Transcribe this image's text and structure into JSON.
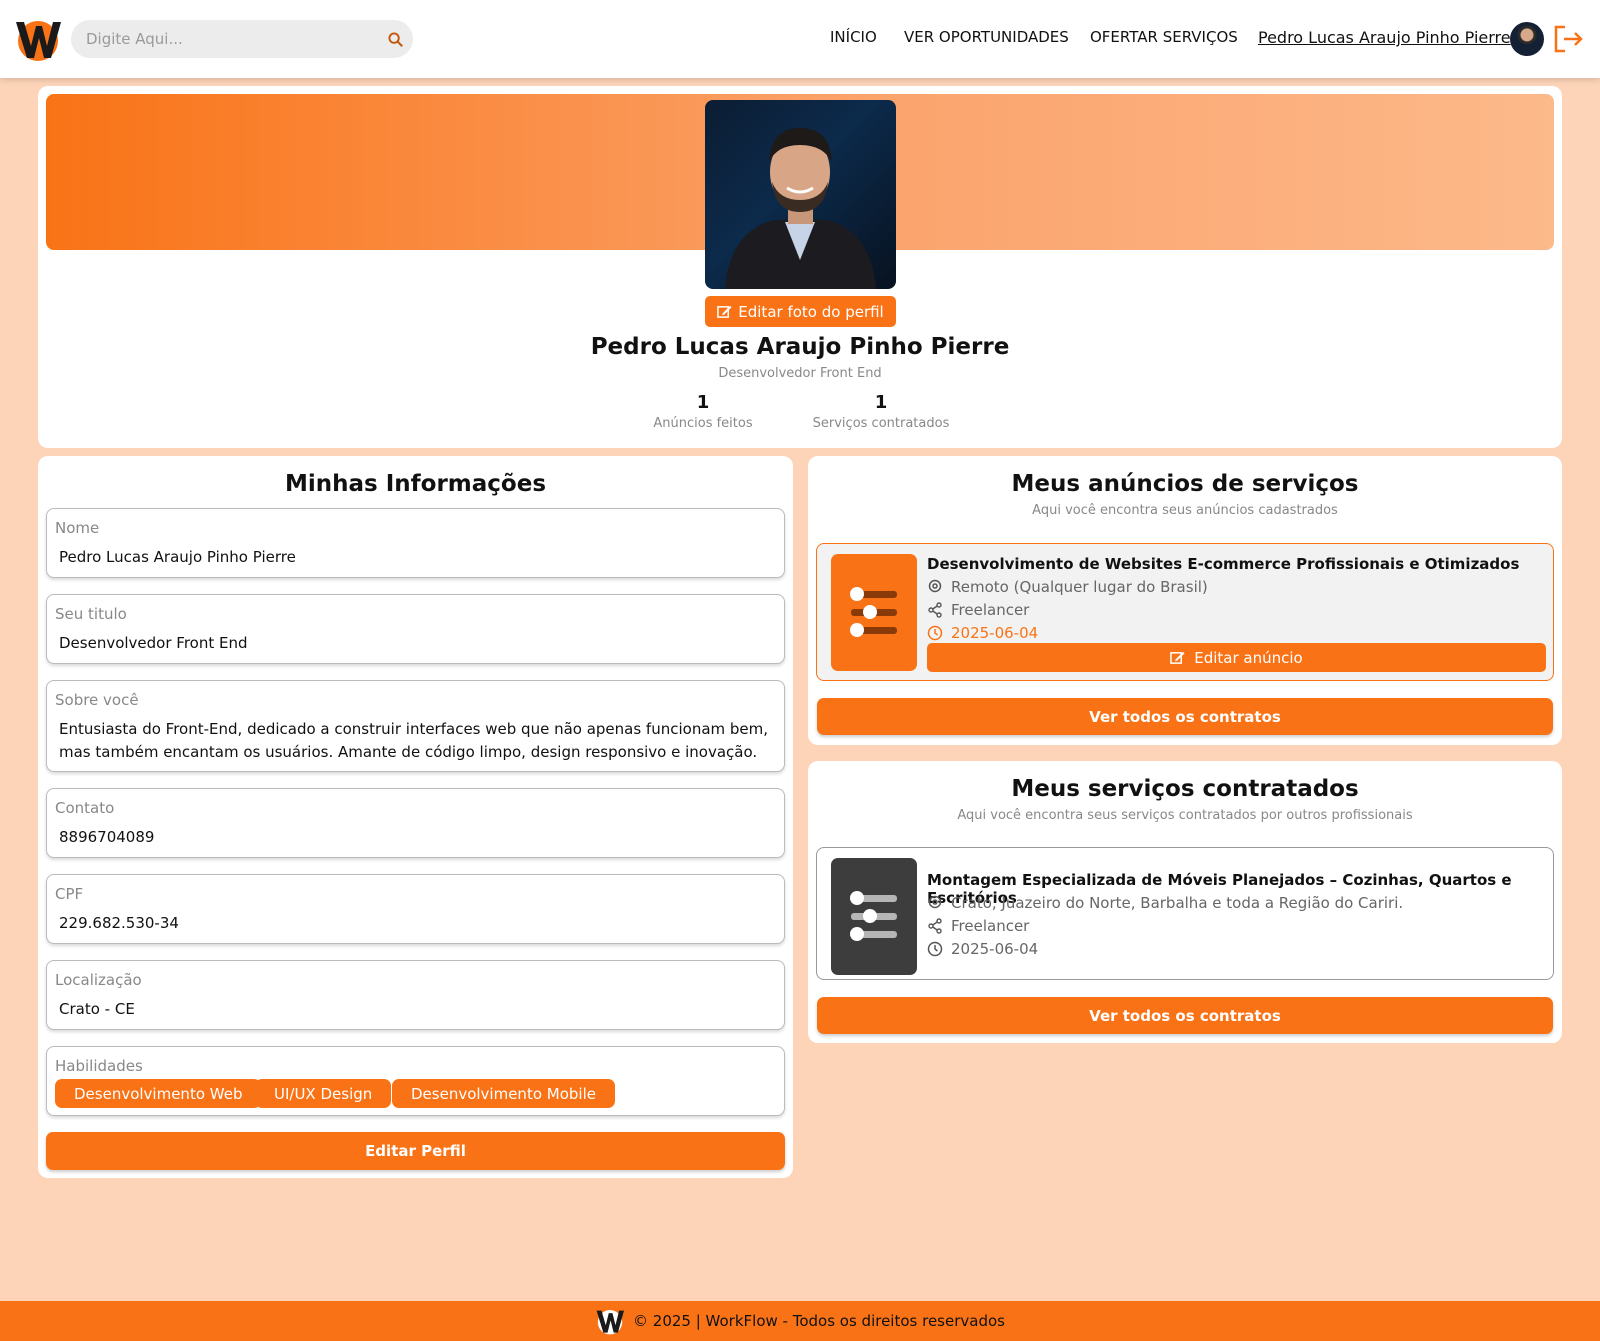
{
  "header": {
    "search_placeholder": "Digite Aqui...",
    "nav": [
      "INÍCIO",
      "VER OPORTUNIDADES",
      "OFERTAR SERVIÇOS"
    ],
    "user_name": "Pedro Lucas Araujo Pinho Pierre"
  },
  "profile": {
    "edit_photo_label": "Editar foto do perfil",
    "name": "Pedro Lucas Araujo Pinho Pierre",
    "title": "Desenvolvedor Front End",
    "stats": [
      {
        "value": "1",
        "label": "Anúncios feitos"
      },
      {
        "value": "1",
        "label": "Serviços contratados"
      }
    ]
  },
  "info": {
    "heading": "Minhas Informações",
    "fields": [
      {
        "label": "Nome",
        "value": "Pedro Lucas Araujo Pinho Pierre"
      },
      {
        "label": "Seu titulo",
        "value": "Desenvolvedor Front End"
      },
      {
        "label": "Sobre você",
        "value": "Entusiasta do Front-End, dedicado a construir interfaces web que não apenas funcionam bem, mas também encantam os usuários. Amante de código limpo, design responsivo e inovação."
      },
      {
        "label": "Contato",
        "value": "8896704089"
      },
      {
        "label": "CPF",
        "value": "229.682.530-34"
      },
      {
        "label": "Localização",
        "value": "Crato - CE"
      }
    ],
    "skills_label": "Habilidades",
    "skills": [
      "Desenvolvimento Web",
      "UI/UX Design",
      "Desenvolvimento Mobile"
    ],
    "edit_profile_label": "Editar Perfil"
  },
  "ads": {
    "heading": "Meus anúncios de serviços",
    "subheading": "Aqui você encontra seus anúncios cadastrados",
    "item": {
      "title": "Desenvolvimento de Websites E-commerce Profissionais e Otimizados",
      "location": "Remoto (Qualquer lugar do Brasil)",
      "type": "Freelancer",
      "date": "2025-06-04",
      "edit_label": "Editar anúncio"
    },
    "view_all_label": "Ver todos os contratos"
  },
  "contracted": {
    "heading": "Meus serviços contratados",
    "subheading": "Aqui você encontra seus serviços contratados por outros profissionais",
    "item": {
      "title": "Montagem Especializada de Móveis Planejados – Cozinhas, Quartos e Escritórios",
      "location": "Crato, Juazeiro do Norte, Barbalha e toda a Região do Cariri.",
      "type": "Freelancer",
      "date": "2025-06-04"
    },
    "view_all_label": "Ver todos os contratos"
  },
  "footer": {
    "text": "© 2025 | WorkFlow - Todos os direitos reservados"
  },
  "colors": {
    "accent": "#f97316",
    "page_bg": "#fdd4b8",
    "thumb_dark": "#3d3d3d"
  }
}
